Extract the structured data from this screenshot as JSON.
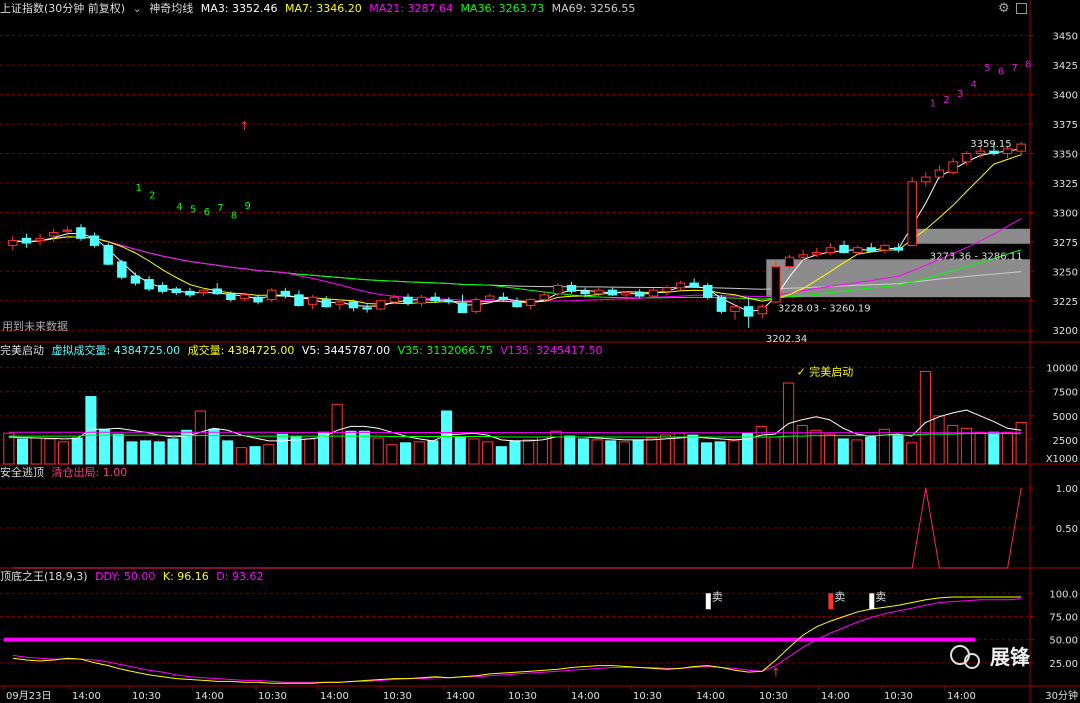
{
  "colors": {
    "bg": "#000000",
    "up": "#ff3232",
    "down": "#54ffff",
    "grid": "#7a0000",
    "white": "#ffffff",
    "yellow": "#ffff00",
    "magenta": "#ff00ff",
    "green": "#00ff00",
    "gray": "#8c8c8c"
  },
  "header": {
    "main_title": "上证指数(30分钟 前复权)",
    "indicator_name": "神奇均线",
    "ma3": "MA3: 3352.46",
    "ma7": "MA7: 3346.20",
    "ma21": "MA21: 3287.64",
    "ma36": "MA36: 3263.73",
    "ma69": "MA69: 3256.55",
    "icons": [
      "gear-icon",
      "window-icon"
    ]
  },
  "price_panel": {
    "note": "用到未来数据",
    "axis_ticks": [
      "3450",
      "3425",
      "3400",
      "3375",
      "3350",
      "3325",
      "3300",
      "3275",
      "3250",
      "3225",
      "3200"
    ],
    "annotations": {
      "low_label": "3202.34",
      "box1_label": "3228.03 - 3260.19",
      "box2_label": "3273.36 - 3286.11",
      "high_label": "3359.15"
    },
    "count_labels_green": [
      "1",
      "2",
      "4",
      "5",
      "6",
      "7",
      "8",
      "9"
    ],
    "count_labels_purple": [
      "1",
      "2",
      "3",
      "4",
      "5",
      "6",
      "7",
      "8"
    ]
  },
  "volume_panel": {
    "name": "完美启动",
    "virtual_vol": "虚拟成交量: 4384725.00",
    "vol": "成交量: 4384725.00",
    "v5": "V5: 3445787.00",
    "v35": "V35: 3132066.75",
    "v135": "V135: 3245417.50",
    "axis_ticks": [
      "10000",
      "7500",
      "5000",
      "2500"
    ],
    "unit": "X1000",
    "signal_label": "完美启动"
  },
  "escape_panel": {
    "name": "安全逃顶",
    "value_label": "清仓出局: 1.00",
    "axis_ticks": [
      "1.00",
      "0.50"
    ]
  },
  "kdj_panel": {
    "name": "顶底之王(18,9,3)",
    "ddy": "DDY: 50.00",
    "k": "K: 96.16",
    "d": "D: 93.62",
    "axis_ticks": [
      "100.0",
      "75.00",
      "50.00",
      "25.00"
    ],
    "sell_label": "卖"
  },
  "time_axis": {
    "labels": [
      "09月23日",
      "14:00",
      "10:30",
      "14:00",
      "10:30",
      "14:00",
      "10:30",
      "14:00",
      "10:30",
      "14:00",
      "10:30",
      "14:00",
      "10:30",
      "14:00",
      "10:30",
      "14:00"
    ],
    "period": "30分钟"
  },
  "watermark": {
    "text": "展锋"
  },
  "chart_data": [
    {
      "type": "candlestick",
      "title": "上证指数(30分钟 前复权)",
      "ylim": [
        3190,
        3465
      ],
      "candles": [
        [
          3272,
          3280,
          3268,
          3276
        ],
        [
          3278,
          3282,
          3270,
          3274
        ],
        [
          3276,
          3282,
          3272,
          3278
        ],
        [
          3280,
          3286,
          3275,
          3283
        ],
        [
          3284,
          3288,
          3279,
          3285
        ],
        [
          3287,
          3290,
          3276,
          3278
        ],
        [
          3280,
          3283,
          3270,
          3272
        ],
        [
          3272,
          3274,
          3255,
          3256
        ],
        [
          3258,
          3260,
          3243,
          3245
        ],
        [
          3246,
          3249,
          3238,
          3240
        ],
        [
          3243,
          3246,
          3233,
          3235
        ],
        [
          3238,
          3241,
          3231,
          3233
        ],
        [
          3235,
          3237,
          3230,
          3232
        ],
        [
          3233,
          3236,
          3228,
          3230
        ],
        [
          3232,
          3236,
          3229,
          3234
        ],
        [
          3235,
          3240,
          3230,
          3231
        ],
        [
          3231,
          3233,
          3224,
          3226
        ],
        [
          3227,
          3232,
          3225,
          3230
        ],
        [
          3228,
          3230,
          3222,
          3224
        ],
        [
          3226,
          3236,
          3224,
          3234
        ],
        [
          3233,
          3236,
          3227,
          3229
        ],
        [
          3230,
          3234,
          3220,
          3221
        ],
        [
          3222,
          3230,
          3218,
          3228
        ],
        [
          3226,
          3229,
          3219,
          3220
        ],
        [
          3222,
          3226,
          3217,
          3224
        ],
        [
          3224,
          3226,
          3216,
          3219
        ],
        [
          3219,
          3222,
          3215,
          3218
        ],
        [
          3218,
          3226,
          3217,
          3225
        ],
        [
          3224,
          3230,
          3222,
          3228
        ],
        [
          3228,
          3231,
          3221,
          3223
        ],
        [
          3223,
          3230,
          3220,
          3228
        ],
        [
          3228,
          3232,
          3223,
          3225
        ],
        [
          3225,
          3228,
          3222,
          3224
        ],
        [
          3223,
          3230,
          3215,
          3215
        ],
        [
          3216,
          3228,
          3214,
          3226
        ],
        [
          3226,
          3231,
          3223,
          3229
        ],
        [
          3228,
          3232,
          3224,
          3226
        ],
        [
          3224,
          3228,
          3219,
          3220
        ],
        [
          3221,
          3227,
          3218,
          3226
        ],
        [
          3226,
          3232,
          3224,
          3230
        ],
        [
          3231,
          3240,
          3229,
          3238
        ],
        [
          3238,
          3241,
          3231,
          3233
        ],
        [
          3233,
          3236,
          3228,
          3231
        ],
        [
          3231,
          3236,
          3229,
          3234
        ],
        [
          3234,
          3236,
          3229,
          3230
        ],
        [
          3230,
          3233,
          3226,
          3232
        ],
        [
          3232,
          3235,
          3227,
          3229
        ],
        [
          3229,
          3236,
          3227,
          3234
        ],
        [
          3233,
          3238,
          3230,
          3236
        ],
        [
          3236,
          3242,
          3234,
          3240
        ],
        [
          3240,
          3244,
          3236,
          3237
        ],
        [
          3238,
          3240,
          3226,
          3228
        ],
        [
          3228,
          3230,
          3214,
          3216
        ],
        [
          3216,
          3222,
          3209,
          3220
        ],
        [
          3220,
          3228,
          3202,
          3212
        ],
        [
          3214,
          3222,
          3210,
          3220
        ],
        [
          3224,
          3258,
          3223,
          3254
        ],
        [
          3254,
          3264,
          3251,
          3262
        ],
        [
          3262,
          3268,
          3258,
          3264
        ],
        [
          3264,
          3270,
          3262,
          3266
        ],
        [
          3266,
          3274,
          3264,
          3270
        ],
        [
          3272,
          3276,
          3265,
          3266
        ],
        [
          3266,
          3272,
          3264,
          3270
        ],
        [
          3270,
          3274,
          3266,
          3267
        ],
        [
          3268,
          3273,
          3265,
          3272
        ],
        [
          3270,
          3274,
          3266,
          3268
        ],
        [
          3272,
          3330,
          3271,
          3326
        ],
        [
          3326,
          3334,
          3322,
          3330
        ],
        [
          3330,
          3340,
          3328,
          3336
        ],
        [
          3334,
          3346,
          3332,
          3343
        ],
        [
          3343,
          3352,
          3340,
          3350
        ],
        [
          3350,
          3357,
          3346,
          3352
        ],
        [
          3352,
          3359,
          3348,
          3350
        ],
        [
          3350,
          3356,
          3346,
          3354
        ],
        [
          3352,
          3360,
          3348,
          3358
        ]
      ],
      "boxes": [
        {
          "label": "3228.03 - 3260.19",
          "y": [
            3228.03,
            3260.19
          ]
        },
        {
          "label": "3273.36 - 3286.11",
          "y": [
            3273.36,
            3286.11
          ]
        }
      ]
    },
    {
      "type": "bar",
      "title": "完美启动",
      "unit": "X1000",
      "ylim": [
        0,
        11000
      ],
      "values": [
        3200,
        2600,
        2700,
        2600,
        2300,
        2700,
        7000,
        3600,
        3100,
        2300,
        2400,
        2300,
        2600,
        3500,
        5500,
        3600,
        2400,
        1700,
        1800,
        2000,
        3100,
        2800,
        2600,
        3300,
        6200,
        3400,
        3400,
        2700,
        2000,
        2200,
        2300,
        2400,
        5500,
        2800,
        2600,
        2300,
        1800,
        2400,
        2500,
        2800,
        3400,
        2900,
        2600,
        2500,
        2400,
        2300,
        2500,
        2700,
        3000,
        3200,
        3000,
        2200,
        2300,
        2400,
        3200,
        3900,
        2800,
        8400,
        4000,
        3500,
        3100,
        2600,
        2500,
        2800,
        3600,
        3000,
        2200,
        9600,
        5000,
        4000,
        3700,
        3300,
        3300,
        3300,
        4300
      ],
      "series": [
        {
          "name": "V5",
          "values": [
            2800,
            2750,
            2700,
            2680,
            2600,
            2650,
            3600,
            3600,
            3700,
            3500,
            3300,
            3000,
            2800,
            2900,
            3300,
            3700,
            3500,
            3000,
            2700,
            2400,
            2400,
            2500,
            2600,
            2800,
            3500,
            3900,
            3900,
            3700,
            3300,
            2900,
            2600,
            2400,
            3000,
            3100,
            3200,
            3000,
            2500,
            2400,
            2400,
            2500,
            2800,
            2800,
            2800,
            2700,
            2600,
            2500,
            2500,
            2500,
            2600,
            2700,
            2800,
            2700,
            2600,
            2500,
            2600,
            3000,
            3100,
            4200,
            4600,
            4900,
            4600,
            3700,
            3100,
            2900,
            3000,
            3100,
            2900,
            4300,
            4900,
            5300,
            5600,
            5000,
            4400,
            3700,
            3500
          ]
        },
        {
          "name": "V35",
          "values": [
            2900,
            2900,
            2900,
            2900,
            2900,
            2900,
            3000,
            3000,
            3000,
            3000,
            3000,
            3000,
            2950,
            2950,
            2950,
            2950,
            2950,
            2950,
            2900,
            2900,
            2900,
            2900,
            2900,
            2900,
            2900,
            2900,
            2900,
            2900,
            2850,
            2850,
            2850,
            2850,
            2850,
            2850,
            2850,
            2850,
            2800,
            2800,
            2800,
            2800,
            2800,
            2800,
            2800,
            2800,
            2800,
            2800,
            2800,
            2800,
            2800,
            2800,
            2800,
            2800,
            2800,
            2800,
            2800,
            2800,
            2800,
            2900,
            2900,
            2950,
            2950,
            2950,
            2950,
            2950,
            3000,
            3000,
            3000,
            3100,
            3100,
            3100,
            3150,
            3150,
            3150,
            3150,
            3130
          ]
        },
        {
          "name": "V135",
          "values": [
            3300,
            3300,
            3300,
            3300,
            3300,
            3300,
            3300,
            3300,
            3300,
            3300,
            3300,
            3300,
            3300,
            3300,
            3300,
            3300,
            3300,
            3300,
            3300,
            3300,
            3280,
            3280,
            3280,
            3280,
            3280,
            3280,
            3280,
            3280,
            3270,
            3270,
            3270,
            3270,
            3270,
            3270,
            3270,
            3270,
            3260,
            3260,
            3260,
            3260,
            3260,
            3260,
            3260,
            3260,
            3250,
            3250,
            3250,
            3250,
            3250,
            3250,
            3250,
            3250,
            3250,
            3250,
            3250,
            3250,
            3250,
            3250,
            3250,
            3250,
            3250,
            3250,
            3250,
            3250,
            3250,
            3250,
            3250,
            3250,
            3250,
            3250,
            3250,
            3250,
            3250,
            3250,
            3245
          ]
        }
      ]
    },
    {
      "type": "line",
      "title": "安全逃顶",
      "ylim": [
        0,
        1.1
      ],
      "series": [
        {
          "name": "清仓出局",
          "values": [
            0,
            0,
            0,
            0,
            0,
            0,
            0,
            0,
            0,
            0,
            0,
            0,
            0,
            0,
            0,
            0,
            0,
            0,
            0,
            0,
            0,
            0,
            0,
            0,
            0,
            0,
            0,
            0,
            0,
            0,
            0,
            0,
            0,
            0,
            0,
            0,
            0,
            0,
            0,
            0,
            0,
            0,
            0,
            0,
            0,
            0,
            0,
            0,
            0,
            0,
            0,
            0,
            0,
            0,
            0,
            0,
            0,
            0,
            0,
            0,
            0,
            0,
            0,
            0,
            0,
            0,
            0,
            1,
            0,
            0,
            0,
            0,
            0,
            0,
            1
          ]
        }
      ]
    },
    {
      "type": "line",
      "title": "顶底之王(18,9,3)",
      "ylim": [
        0,
        110
      ],
      "series": [
        {
          "name": "DDY",
          "values": [
            50,
            50,
            50,
            50,
            50,
            50,
            50,
            50,
            50,
            50,
            50,
            50,
            50,
            50,
            50,
            50,
            50,
            50,
            50,
            50,
            50,
            50,
            50,
            50,
            50,
            50,
            50,
            50,
            50,
            50,
            50,
            50,
            50,
            50,
            50,
            50,
            50,
            50,
            50,
            50,
            50,
            50,
            50,
            50,
            50,
            50,
            50,
            50,
            50,
            50,
            50,
            50,
            50,
            50,
            50,
            50,
            50,
            50,
            50,
            50,
            50,
            50,
            50,
            50,
            50,
            50,
            50,
            50,
            50,
            50,
            50,
            50,
            50,
            50,
            50
          ]
        },
        {
          "name": "K",
          "values": [
            30,
            28,
            27,
            28,
            30,
            29,
            25,
            22,
            18,
            15,
            12,
            10,
            8,
            7,
            6,
            5,
            5,
            4,
            4,
            3,
            3,
            3,
            3,
            4,
            4,
            5,
            6,
            7,
            8,
            8,
            9,
            10,
            9,
            10,
            11,
            13,
            14,
            15,
            16,
            17,
            18,
            20,
            21,
            22,
            22,
            21,
            20,
            19,
            18,
            19,
            21,
            22,
            20,
            17,
            15,
            16,
            28,
            42,
            55,
            64,
            70,
            75,
            80,
            83,
            85,
            87,
            90,
            93,
            95,
            96,
            96,
            96,
            96,
            96,
            96
          ]
        },
        {
          "name": "D",
          "values": [
            33,
            31,
            30,
            29,
            29,
            29,
            28,
            26,
            23,
            20,
            17,
            15,
            12,
            10,
            9,
            8,
            7,
            6,
            6,
            5,
            4,
            4,
            4,
            4,
            4,
            5,
            5,
            6,
            7,
            8,
            8,
            9,
            9,
            10,
            10,
            11,
            12,
            13,
            14,
            15,
            16,
            17,
            18,
            19,
            20,
            20,
            20,
            20,
            19,
            19,
            20,
            21,
            20,
            19,
            17,
            16,
            22,
            32,
            42,
            50,
            57,
            63,
            69,
            74,
            78,
            81,
            84,
            87,
            90,
            91,
            92,
            93,
            93,
            93,
            94
          ]
        }
      ]
    }
  ]
}
